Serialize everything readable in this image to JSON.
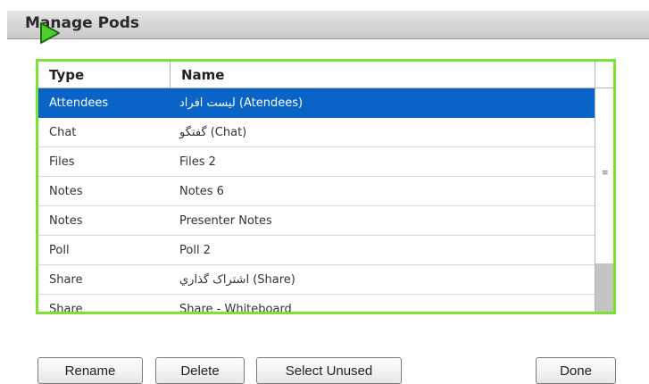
{
  "dialog": {
    "title": "Manage Pods"
  },
  "table": {
    "columns": [
      "Type",
      "Name"
    ],
    "rows": [
      {
        "type": "Attendees",
        "name": "لیست افراد (Atendees)",
        "selected": true
      },
      {
        "type": "Chat",
        "name": "گفتگو (Chat)"
      },
      {
        "type": "Files",
        "name": "Files 2"
      },
      {
        "type": "Notes",
        "name": "Notes 6"
      },
      {
        "type": "Notes",
        "name": "Presenter Notes"
      },
      {
        "type": "Poll",
        "name": "Poll 2"
      },
      {
        "type": "Share",
        "name": "اشتراک گذاري (Share)"
      },
      {
        "type": "Share",
        "name": "Share - Whiteboard"
      }
    ],
    "scroll_grip": "≡"
  },
  "buttons": {
    "rename": "Rename",
    "delete": "Delete",
    "select_unused": "Select Unused",
    "done": "Done"
  },
  "colors": {
    "selection": "#0a64c8",
    "focus_outline": "#7be234",
    "cursor": "#4cd12a"
  },
  "icons": {
    "cursor": "mouse-pointer-icon"
  }
}
